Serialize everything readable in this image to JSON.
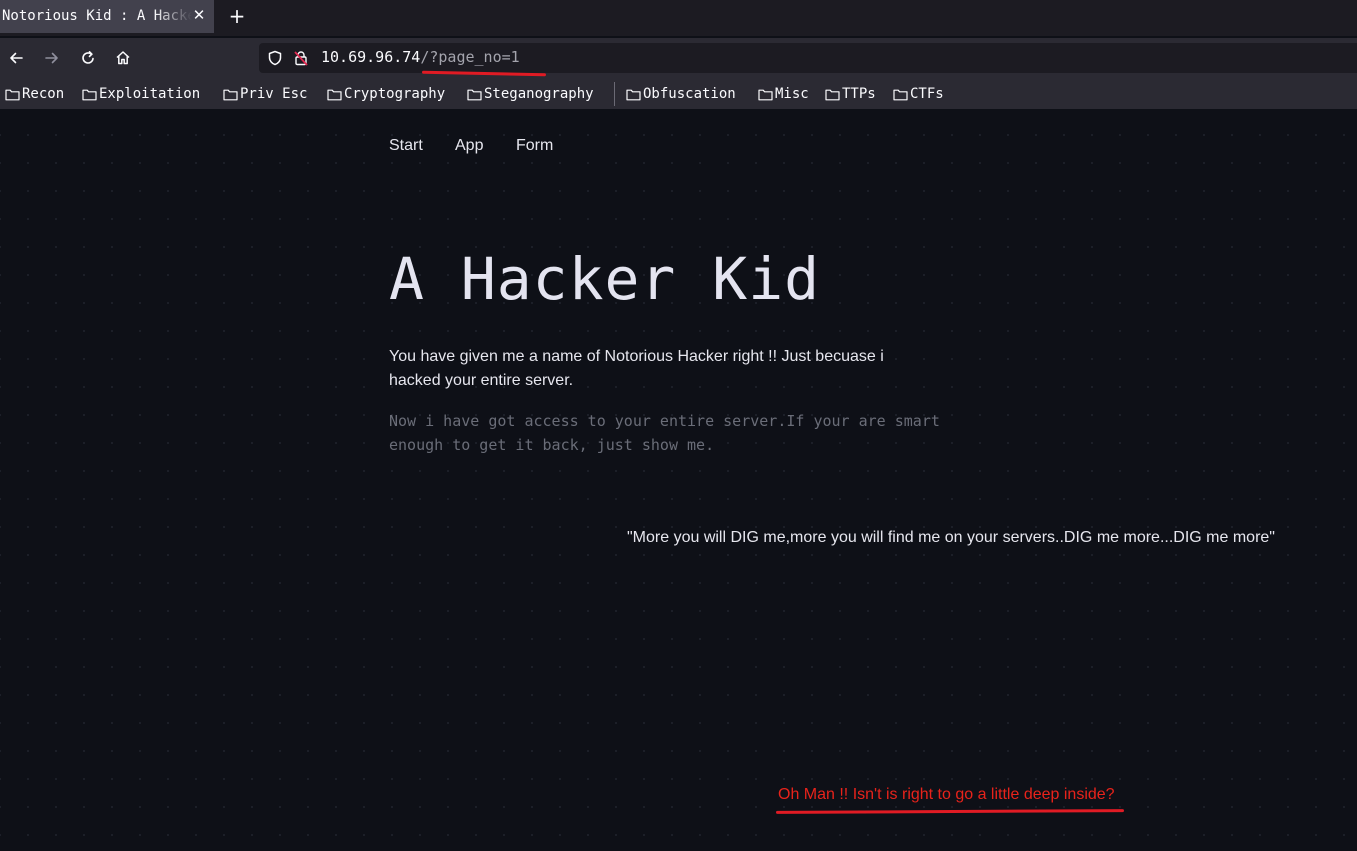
{
  "browser": {
    "tab": {
      "title": "Notorious Kid : A Hacker Kid",
      "close_icon": "close-icon"
    },
    "new_tab_icon": "plus-icon",
    "nav": {
      "back_icon": "arrow-left-icon",
      "forward_icon": "arrow-right-icon",
      "reload_icon": "reload-icon",
      "home_icon": "home-icon"
    },
    "url": {
      "host": "10.69.96.74",
      "path": "/?page_no=1"
    },
    "bookmarks": [
      {
        "label": "Recon"
      },
      {
        "label": "Exploitation"
      },
      {
        "label": "Priv Esc"
      },
      {
        "label": "Cryptography"
      },
      {
        "label": "Steganography"
      },
      {
        "label": "Obfuscation"
      },
      {
        "label": "Misc"
      },
      {
        "label": "TTPs"
      },
      {
        "label": "CTFs"
      }
    ]
  },
  "site": {
    "nav": [
      "Start",
      "App",
      "Form"
    ],
    "title": "A Hacker Kid",
    "intro": "You have given me a name of Notorious Hacker right !! Just becuase i hacked your entire server.",
    "subtext": "Now i have got access to your entire server.If your are smart enough to get it back, just show me.",
    "quote": "\"More you will DIG me,more you will find me on your servers..DIG me more...DIG me more\"",
    "hint": "Oh Man !! Isn't is right to go a little deep inside?"
  },
  "colors": {
    "page_background": "#0e1017",
    "annotation_red": "#e01b24",
    "hint_text": "#e8231b"
  }
}
